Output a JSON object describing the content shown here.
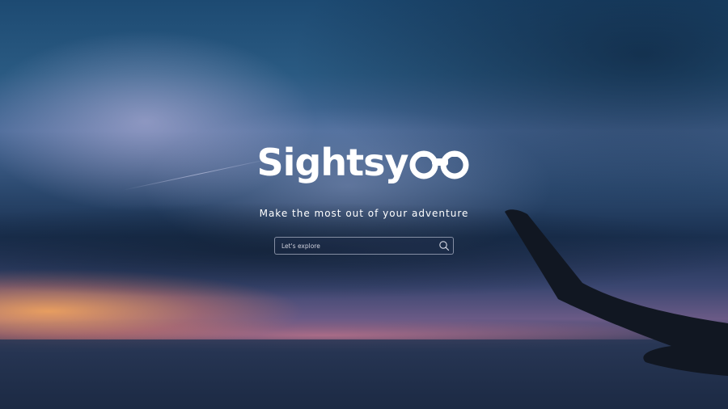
{
  "brand": {
    "name": "Sightsy",
    "icon": "binoculars-icon",
    "tagline": "Make the most out of your adventure"
  },
  "search": {
    "placeholder": "Let's explore",
    "value": "",
    "icon": "search-icon"
  },
  "colors": {
    "text": "#ffffff",
    "sky_top": "#1d4a72",
    "sunset": "#ffaa5a"
  }
}
